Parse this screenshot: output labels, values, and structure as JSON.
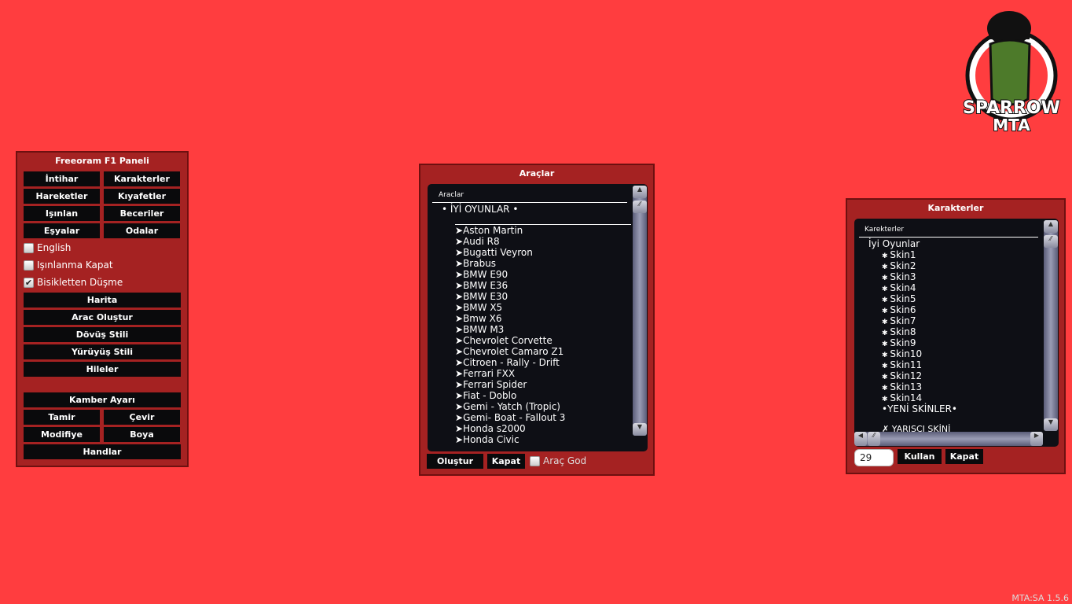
{
  "logo": {
    "text": "SPARROW MTA"
  },
  "version": "MTA:SA 1.5.6",
  "left_panel": {
    "title": "Freeoram F1 Paneli",
    "grid_buttons": [
      "İntihar",
      "Karakterler",
      "Hareketler",
      "Kıyafetler",
      "Işınlan",
      "Beceriler",
      "Eşyalar",
      "Odalar"
    ],
    "checkboxes": [
      {
        "label": "English",
        "checked": false
      },
      {
        "label": "Işınlanma Kapat",
        "checked": false
      },
      {
        "label": "Bisikletten Düşme",
        "checked": true
      }
    ],
    "wide_buttons": [
      "Harita",
      "Arac Oluştur",
      "Dövüş Stili",
      "Yürüyüş Stili",
      "Hileler"
    ],
    "kamber": "Kamber Ayarı",
    "grid2": [
      "Tamir",
      "Çevir",
      "Modifiye",
      "Boya"
    ],
    "handlar": "Handlar"
  },
  "vehicles_panel": {
    "title": "Araçlar",
    "column": "Araclar",
    "group": "• İYİ OYUNLAR •",
    "items": [
      "Aston Martin",
      "Audi R8",
      "Bugatti Veyron",
      "Brabus",
      "BMW E90",
      "BMW E36",
      "BMW E30",
      "BMW X5",
      "Bmw X6",
      "BMW M3",
      "Chevrolet Corvette",
      "Chevrolet Camaro Z1",
      "Citroen - Rally - Drift",
      "Ferrari FXX",
      "Ferrari Spider",
      "Fiat - Doblo",
      "Gemi - Yatch (Tropic)",
      "Gemi- Boat - Fallout 3",
      "Honda s2000",
      "Honda Civic"
    ],
    "create": "Oluştur",
    "close": "Kapat",
    "god": {
      "label": "Araç God",
      "checked": false
    }
  },
  "chars_panel": {
    "title": "Karakterler",
    "column": "Karekterler",
    "group": "İyi Oyunlar",
    "items": [
      "Skin1",
      "Skin2",
      "Skin3",
      "Skin4",
      "Skin5",
      "Skin6",
      "Skin7",
      "Skin8",
      "Skin9",
      "Skin10",
      "Skin11",
      "Skin12",
      "Skin13",
      "Skin14"
    ],
    "group2": "•YENİ SKİNLER•",
    "partial": "✗ YARIŞÇI SKİNİ",
    "input_value": "29",
    "use": "Kullan",
    "close": "Kapat"
  }
}
